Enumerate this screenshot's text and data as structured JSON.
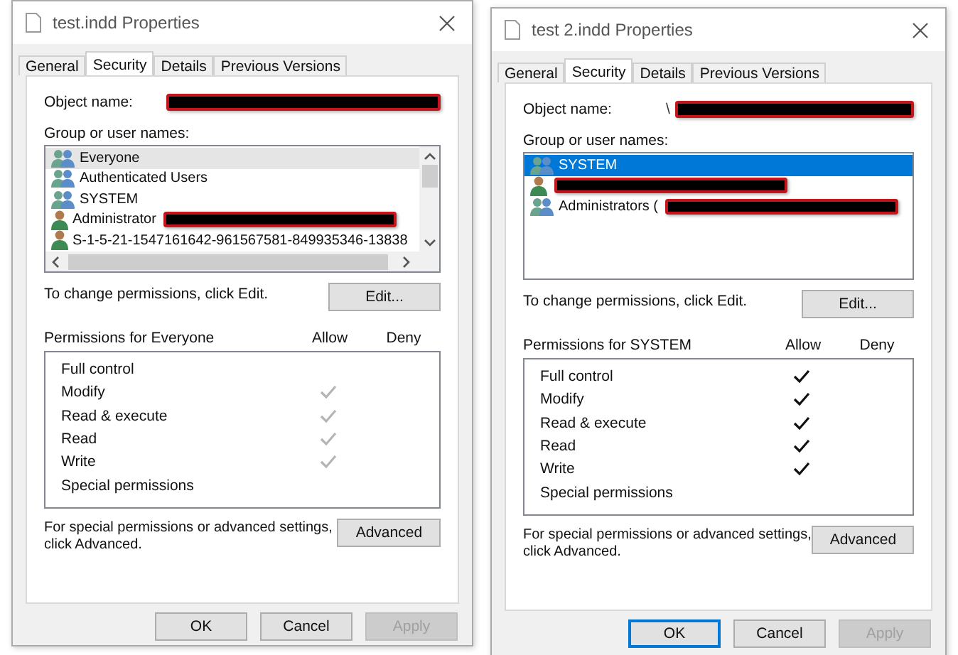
{
  "dialogs": [
    {
      "title": "test.indd Properties",
      "offset": false,
      "tabs": [
        {
          "label": "General",
          "selected": false
        },
        {
          "label": "Security",
          "selected": true
        },
        {
          "label": "Details",
          "selected": false
        },
        {
          "label": "Previous Versions",
          "selected": false
        }
      ],
      "object_name": {
        "label": "Object name:",
        "redacted": true
      },
      "group_label": "Group or user names:",
      "users": {
        "scrollbars": true,
        "items": [
          {
            "kind": "group",
            "label": "Everyone",
            "selected": true,
            "redacted": false
          },
          {
            "kind": "group",
            "label": "Authenticated Users",
            "selected": false,
            "redacted": false
          },
          {
            "kind": "group",
            "label": "SYSTEM",
            "selected": false,
            "redacted": false
          },
          {
            "kind": "user",
            "label": "Administrator",
            "selected": false,
            "redacted": true
          },
          {
            "kind": "user",
            "label": "S-1-5-21-1547161642-961567581-849935346-13838",
            "selected": false,
            "redacted": false
          }
        ]
      },
      "change_text": "To change permissions, click Edit.",
      "edit_button": "Edit...",
      "permissions_title": "Permissions for Everyone",
      "allow_header": "Allow",
      "deny_header": "Deny",
      "checks_greyed": true,
      "permissions": [
        {
          "name": "Full control",
          "allow": false
        },
        {
          "name": "Modify",
          "allow": true
        },
        {
          "name": "Read & execute",
          "allow": true
        },
        {
          "name": "Read",
          "allow": true
        },
        {
          "name": "Write",
          "allow": true
        },
        {
          "name": "Special permissions",
          "allow": false
        }
      ],
      "advanced_text": "For special permissions or advanced settings, click Advanced.",
      "advanced_button": "Advanced",
      "buttons": [
        {
          "label": "OK",
          "focused": false,
          "disabled": false
        },
        {
          "label": "Cancel",
          "focused": false,
          "disabled": false
        },
        {
          "label": "Apply",
          "focused": false,
          "disabled": true
        }
      ]
    },
    {
      "title": "test 2.indd Properties",
      "offset": true,
      "tabs": [
        {
          "label": "General",
          "selected": false
        },
        {
          "label": "Security",
          "selected": true
        },
        {
          "label": "Details",
          "selected": false
        },
        {
          "label": "Previous Versions",
          "selected": false
        }
      ],
      "object_name": {
        "label": "Object name:",
        "value": "\\",
        "redacted": true
      },
      "group_label": "Group or user names:",
      "users": {
        "scrollbars": false,
        "items": [
          {
            "kind": "group",
            "label": "SYSTEM",
            "selected": true,
            "redacted": false
          },
          {
            "kind": "user",
            "selected": false,
            "redacted": true
          },
          {
            "kind": "group",
            "label": "Administrators (",
            "selected": false,
            "redacted": true
          }
        ]
      },
      "change_text": "To change permissions, click Edit.",
      "edit_button": "Edit...",
      "permissions_title": "Permissions for SYSTEM",
      "allow_header": "Allow",
      "deny_header": "Deny",
      "checks_greyed": false,
      "permissions": [
        {
          "name": "Full control",
          "allow": true
        },
        {
          "name": "Modify",
          "allow": true
        },
        {
          "name": "Read & execute",
          "allow": true
        },
        {
          "name": "Read",
          "allow": true
        },
        {
          "name": "Write",
          "allow": true
        },
        {
          "name": "Special permissions",
          "allow": false
        }
      ],
      "advanced_text": "For special permissions or advanced settings, click Advanced.",
      "advanced_button": "Advanced",
      "buttons": [
        {
          "label": "OK",
          "focused": true,
          "disabled": false
        },
        {
          "label": "Cancel",
          "focused": false,
          "disabled": false
        },
        {
          "label": "Apply",
          "focused": false,
          "disabled": true
        }
      ]
    }
  ]
}
